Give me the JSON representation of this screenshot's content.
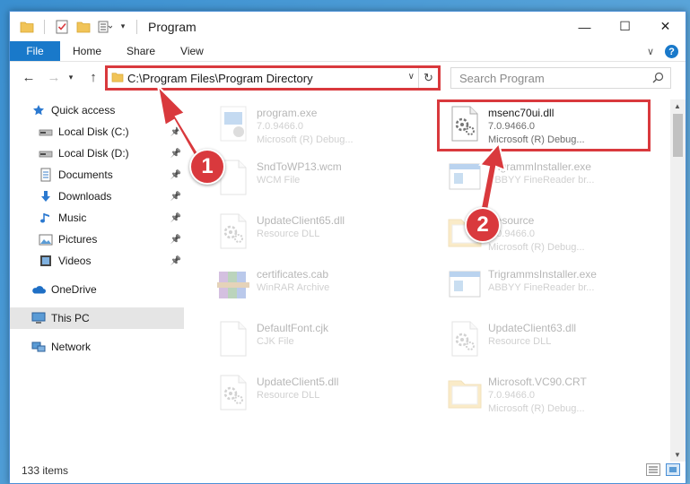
{
  "window": {
    "title": "Program",
    "controls": {
      "minimize": "—",
      "maximize": "☐",
      "close": "✕"
    }
  },
  "ribbon": {
    "tabs": [
      "File",
      "Home",
      "Share",
      "View"
    ],
    "help": "?"
  },
  "navigation": {
    "address": "C:\\Program Files\\Program Directory",
    "search_placeholder": "Search Program"
  },
  "sidebar": {
    "items": [
      {
        "label": "Quick access",
        "icon": "star-icon"
      },
      {
        "label": "Local Disk (C:)",
        "icon": "drive-icon",
        "pinned": true
      },
      {
        "label": "Local Disk (D:)",
        "icon": "drive-icon",
        "pinned": true
      },
      {
        "label": "Documents",
        "icon": "documents-icon",
        "pinned": true
      },
      {
        "label": "Downloads",
        "icon": "download-icon",
        "pinned": true
      },
      {
        "label": "Music",
        "icon": "music-icon",
        "pinned": true
      },
      {
        "label": "Pictures",
        "icon": "pictures-icon",
        "pinned": true
      },
      {
        "label": "Videos",
        "icon": "videos-icon",
        "pinned": true
      },
      {
        "label": "OneDrive",
        "icon": "cloud-icon"
      },
      {
        "label": "This PC",
        "icon": "computer-icon",
        "selected": true
      },
      {
        "label": "Network",
        "icon": "network-icon"
      }
    ]
  },
  "files": [
    {
      "name": "program.exe",
      "line1": "7.0.9466.0",
      "line2": "Microsoft (R) Debug...",
      "icon": "exe-icon",
      "faded": true
    },
    {
      "name": "msenc70ui.dll",
      "line1": "7.0.9466.0",
      "line2": "Microsoft (R) Debug...",
      "icon": "dll-icon",
      "faded": false,
      "highlighted": true
    },
    {
      "name": "SndToWP13.wcm",
      "line1": "WCM File",
      "line2": "",
      "icon": "file-icon",
      "faded": true
    },
    {
      "name": "TrigrammInstaller.exe",
      "line1": "ABBYY FineReader br...",
      "line2": "",
      "icon": "installer-icon",
      "faded": true
    },
    {
      "name": "UpdateClient65.dll",
      "line1": "Resource DLL",
      "line2": "",
      "icon": "dll-icon",
      "faded": true
    },
    {
      "name": "Resource",
      "line1": "7.0.9466.0",
      "line2": "Microsoft (R) Debug...",
      "icon": "folder-icon",
      "faded": true
    },
    {
      "name": "certificates.cab",
      "line1": "WinRAR Archive",
      "line2": "",
      "icon": "archive-icon",
      "faded": true
    },
    {
      "name": "TrigrammsInstaller.exe",
      "line1": "ABBYY FineReader br...",
      "line2": "",
      "icon": "installer-icon",
      "faded": true
    },
    {
      "name": "DefaultFont.cjk",
      "line1": "CJK File",
      "line2": "",
      "icon": "file-icon",
      "faded": true
    },
    {
      "name": "UpdateClient63.dll",
      "line1": "Resource DLL",
      "line2": "",
      "icon": "dll-icon",
      "faded": true
    },
    {
      "name": "UpdateClient5.dll",
      "line1": "Resource DLL",
      "line2": "",
      "icon": "dll-icon",
      "faded": true
    },
    {
      "name": "Microsoft.VC90.CRT",
      "line1": "7.0.9466.0",
      "line2": "Microsoft (R) Debug...",
      "icon": "folder-icon",
      "faded": true
    }
  ],
  "status": {
    "item_count": "133 items"
  },
  "annotations": {
    "badge1": "1",
    "badge2": "2",
    "color": "#d9393d"
  }
}
